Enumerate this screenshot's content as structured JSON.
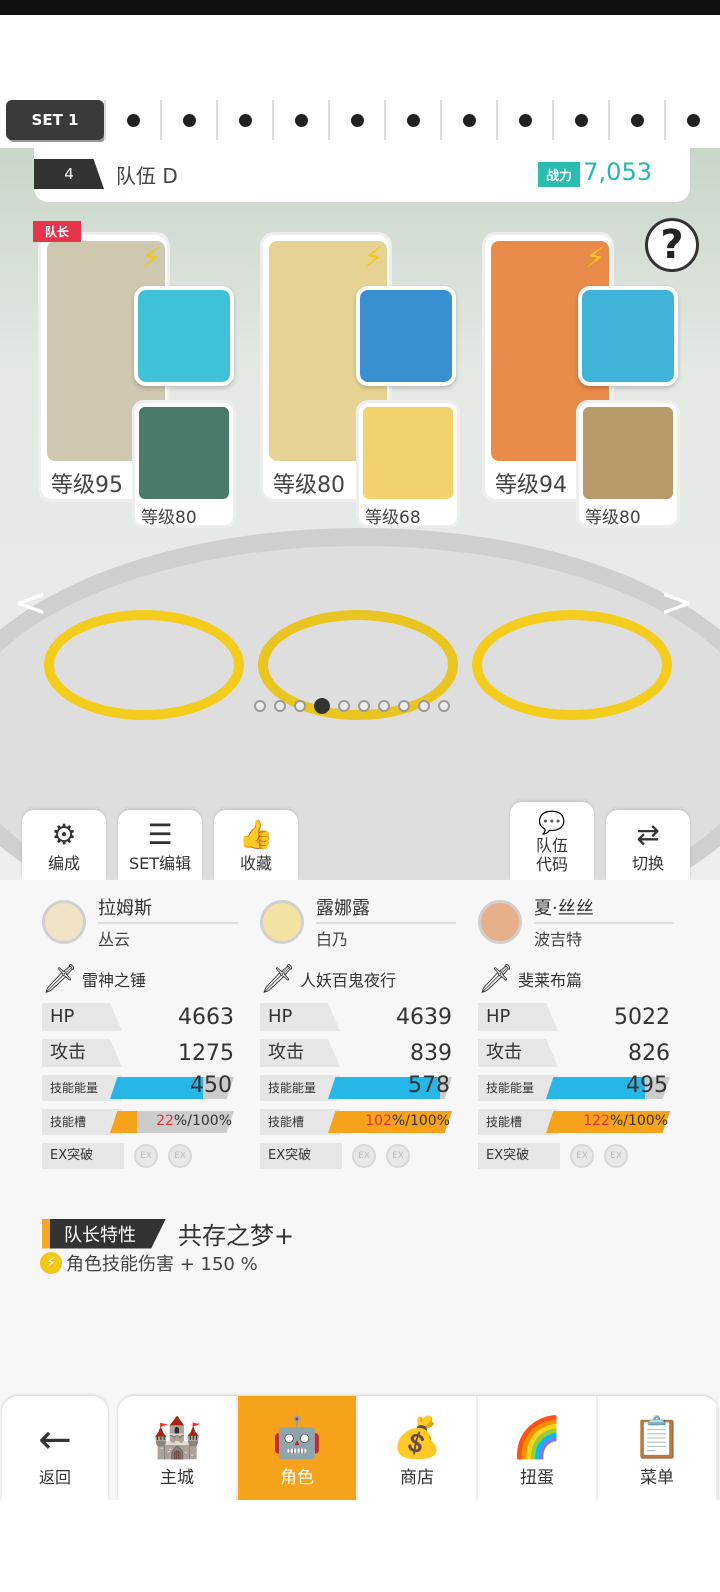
{
  "set_bar": {
    "active": "SET 1",
    "dots": 11
  },
  "team": {
    "number": "4",
    "name": "队伍 D",
    "power_label": "战力",
    "power_value": "7,053"
  },
  "help": "?",
  "cards": [
    {
      "leader_badge": "队长",
      "level": "等级95",
      "sub_level": "等级80",
      "portrait_color": "#cfc8b0",
      "weapon_color": "#3fc2d8",
      "sub_color": "#4a7a6a"
    },
    {
      "level": "等级80",
      "sub_level": "等级68",
      "portrait_color": "#e6d394",
      "weapon_color": "#3a8fd0",
      "sub_color": "#f2d26a"
    },
    {
      "level": "等级94",
      "sub_level": "等级80",
      "portrait_color": "#e88a4a",
      "weapon_color": "#3fb3d8",
      "sub_color": "#b89a6a"
    }
  ],
  "page_dots": {
    "count": 10,
    "active_index": 3
  },
  "scene_buttons": {
    "formation": "编成",
    "set_edit": "SET编辑",
    "favorite": "收藏",
    "team_code": "队伍\n代码",
    "switch": "切换"
  },
  "members": [
    {
      "char_name": "拉姆斯",
      "partner": "丛云",
      "weapon": "雷神之锤",
      "hp": "4663",
      "attack": "1275",
      "skill_energy": "450",
      "skill_energy_fill": 0.75,
      "skill_slot": "22",
      "skill_slot_max": "100",
      "skill_slot_fill": 0.22
    },
    {
      "char_name": "露娜露",
      "partner": "白乃",
      "weapon": "人妖百鬼夜行",
      "hp": "4639",
      "attack": "839",
      "skill_energy": "578",
      "skill_energy_fill": 0.9,
      "skill_slot": "102",
      "skill_slot_max": "100",
      "skill_slot_fill": 1.0
    },
    {
      "char_name": "夏·丝丝",
      "partner": "波吉特",
      "weapon": "斐莱布篇",
      "hp": "5022",
      "attack": "826",
      "skill_energy": "495",
      "skill_energy_fill": 0.8,
      "skill_slot": "122",
      "skill_slot_max": "100",
      "skill_slot_fill": 1.0
    }
  ],
  "stat_labels": {
    "hp": "HP",
    "attack": "攻击",
    "skill_energy": "技能能量",
    "skill_slot": "技能槽",
    "ex": "EX突破",
    "ex_badge": "EX"
  },
  "leader_skill": {
    "label": "队长特性",
    "name": "共存之梦+",
    "effect": "角色技能伤害 + 150 %"
  },
  "nav": {
    "back": "返回",
    "tabs": [
      "主城",
      "角色",
      "商店",
      "扭蛋",
      "菜单"
    ],
    "active_tab": 1
  },
  "colors": {
    "accent": "#f7a21b",
    "power": "#29b6ab",
    "energy": "#27b7e6",
    "slot": "#f7a21b"
  }
}
